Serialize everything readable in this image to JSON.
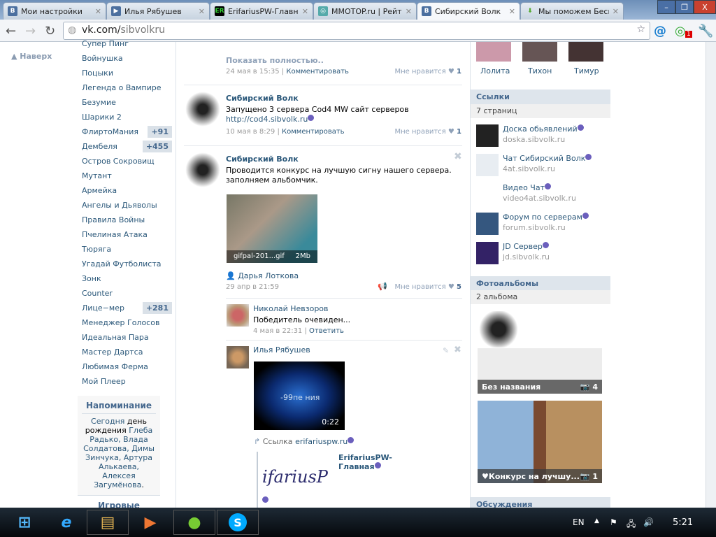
{
  "browser": {
    "tabs": [
      {
        "label": "Мои настройки",
        "fav": "B"
      },
      {
        "label": "Илья Рябушев",
        "fav": "▶"
      },
      {
        "label": "ErifariusPW-Главн",
        "fav": "ER"
      },
      {
        "label": "MMOTOP.ru | Рейт",
        "fav": "◎"
      },
      {
        "label": "Сибирский Волк",
        "fav": "B"
      },
      {
        "label": "Мы поможем Бесп",
        "fav": "⬇"
      }
    ],
    "url_host": "vk.com/",
    "url_path": "sibvolkru",
    "badge": "1",
    "window_min": "–",
    "window_max": "❐",
    "window_close": "X"
  },
  "left": {
    "up": "Наверх",
    "menu": [
      {
        "label": "Супер Пинг"
      },
      {
        "label": "Войнушка"
      },
      {
        "label": "Поцыки"
      },
      {
        "label": "Легенда о Вампире"
      },
      {
        "label": "Безумие"
      },
      {
        "label": "Шарики 2"
      },
      {
        "label": "ФлиртоМания",
        "count": "+91"
      },
      {
        "label": "Дембеля",
        "count": "+455"
      },
      {
        "label": "Остров Сокровищ"
      },
      {
        "label": "Мутант"
      },
      {
        "label": "Армейка"
      },
      {
        "label": "Ангелы и Дьяволы"
      },
      {
        "label": "Правила Войны"
      },
      {
        "label": "Пчелиная Атака"
      },
      {
        "label": "Тюряга"
      },
      {
        "label": "Угадай Футболиста"
      },
      {
        "label": "Зонк"
      },
      {
        "label": "Counter"
      },
      {
        "label": "Лице−мер",
        "count": "+281"
      },
      {
        "label": "Менеджер Голосов"
      },
      {
        "label": "Идеальная Пара"
      },
      {
        "label": "Мастер Дартса"
      },
      {
        "label": "Любимая Ферма"
      },
      {
        "label": "Мой Плеер"
      }
    ],
    "reminder": {
      "title": "Напоминание",
      "t1": "Сегодня ",
      "t2": "день рождения",
      "t3": " Глеба Радько, Влада Солдатова, Димы Зинчука, Артура Алькаева, Алексея Загумёнова",
      "t4": "."
    },
    "games": "Игровые"
  },
  "wall": {
    "show_full": "Показать полностью..",
    "comment": "Комментировать",
    "like": "Мне нравится",
    "p0": {
      "date": "24 мая в 15:35",
      "likes": "1"
    },
    "p1": {
      "author": "Сибирский Волк",
      "text": "Запущено 3 сервера Cod4 MW сайт серверов",
      "link": "http://cod4.sibvolk.ru",
      "date": "10 мая в 8:29",
      "likes": "1"
    },
    "p2": {
      "author": "Сибирский Волк",
      "text1": "Проводится конкурс на лучшую сигну нашего сервера.",
      "text2": "заполняем альбомчик.",
      "file": "gifpal-201...gif",
      "size": "2Mb",
      "attached_user": "Дарья Лоткова",
      "date": "29 апр в 21:59",
      "likes": "5"
    },
    "c1": {
      "author": "Николай Невзоров",
      "text": "Победитель очевиден...",
      "date": "4 мая в 22:31",
      "reply": "Ответить"
    },
    "c2": {
      "author": "Илья Рябушев",
      "video_title": "-99пе ния",
      "duration": "0:22",
      "link_label": "Ссылка",
      "link_host": "erifariuspw.ru",
      "preview_title": "ErifariusPW-Главная",
      "preview_logo": "ifariusP"
    }
  },
  "right": {
    "friends": [
      "Лолита",
      "Тихон",
      "Тимур"
    ],
    "links_title": "Ссылки",
    "links_count": "7 страниц",
    "links": [
      {
        "name": "Доска обьявлений",
        "url": "doska.sibvolk.ru"
      },
      {
        "name": "Чат Сибирский Волк",
        "url": "4at.sibvolk.ru"
      },
      {
        "name": "Видео Чат",
        "url": "video4at.sibvolk.ru"
      },
      {
        "name": "Форум по серверам",
        "url": "forum.sibvolk.ru"
      },
      {
        "name": "JD Сервер",
        "url": "jd.sibvolk.ru"
      }
    ],
    "albums_title": "Фотоальбомы",
    "albums_count": "2 альбома",
    "albums": [
      {
        "name": "Без названия",
        "count": "4"
      },
      {
        "name": "♥Конкурс на лучшу...",
        "count": "1"
      }
    ],
    "discussions": "Обсуждения"
  },
  "taskbar": {
    "lang": "EN",
    "time": "5:21"
  }
}
